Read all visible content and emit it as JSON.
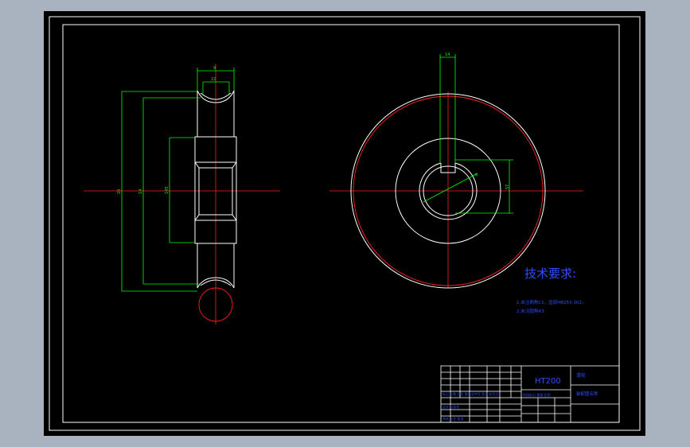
{
  "colors": {
    "background": "#a9b3bf",
    "sheet": "#000000",
    "border": "#ffffff",
    "outline": "#ffffff",
    "centerline": "#ff2020",
    "dimension": "#00ff00",
    "note_text": "#2f4dff",
    "title_block_text": "#2f4dff"
  },
  "drawing": {
    "side_view": {
      "dims": {
        "top_width": "9",
        "top_inner": "22",
        "dia_outer": "20",
        "dia_mid": "14",
        "dia_hub": "145"
      }
    },
    "front_view": {
      "dims": {
        "keyway_width": "14",
        "bore_dia": "6",
        "keyway_depth": "57"
      }
    }
  },
  "technical_requirements": {
    "title": "技术要求:",
    "lines": [
      "1.未注倒角C1，齿部HB255-302。",
      "2.未注圆角R3"
    ]
  },
  "title_block": {
    "material": "HT200",
    "part_name": "滑轮",
    "company": "装配图名称",
    "labels": {
      "row1": "标记 处数 分区 更改文件号 签名 年月日",
      "row2": "阶段标记 重量 比例",
      "row3": "设计 标准化",
      "row4": "审核 工艺 批准"
    }
  }
}
